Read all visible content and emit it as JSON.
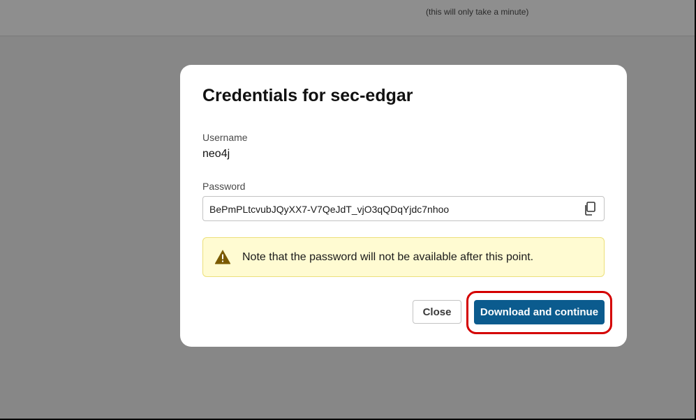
{
  "top_bar": {
    "subtitle": "(this will only take a minute)"
  },
  "modal": {
    "title": "Credentials for sec-edgar",
    "username_label": "Username",
    "username_value": "neo4j",
    "password_label": "Password",
    "password_value": "BePmPLtcvubJQyXX7-V7QeJdT_vjO3qQDqYjdc7nhoo",
    "copy_icon": "copy-icon",
    "warning_icon": "warning-triangle-icon",
    "warning_text": "Note that the password will not be available after this point.",
    "close_label": "Close",
    "download_label": "Download and continue"
  },
  "colors": {
    "backdrop": "#878787",
    "primary_button": "#0b5b8e",
    "warning_bg": "#fffbd2",
    "warning_icon": "#7a5a00",
    "highlight": "#d40000"
  }
}
